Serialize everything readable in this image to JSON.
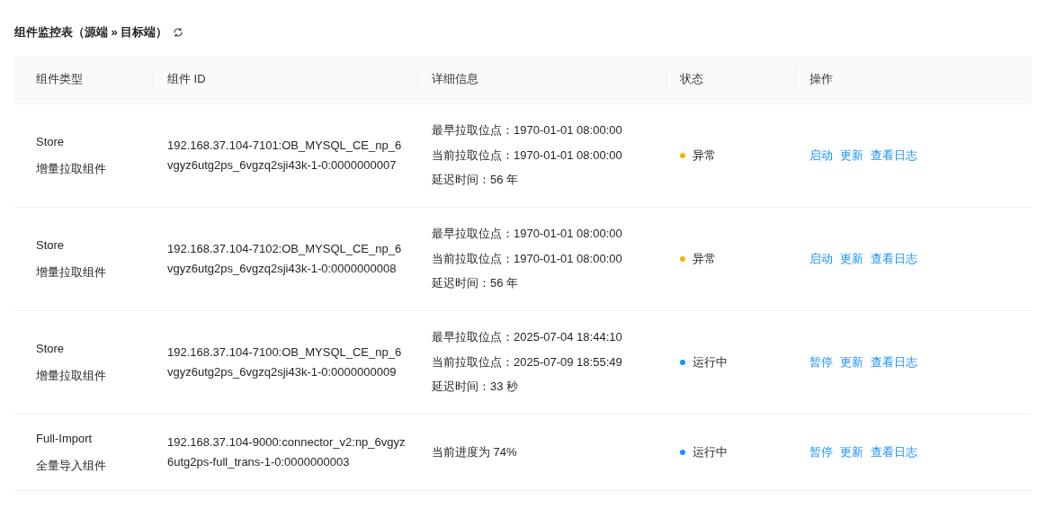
{
  "title": "组件监控表（源端 » 目标端）",
  "columns": [
    "组件类型",
    "组件 ID",
    "详细信息",
    "状态",
    "操作"
  ],
  "rows": [
    {
      "type": "Store",
      "type_label": "增量拉取组件",
      "id": "192.168.37.104-7101:OB_MYSQL_CE_np_6vgyz6utg2ps_6vgzq2sji43k-1-0:0000000007",
      "details": [
        "最早拉取位点：1970-01-01 08:00:00",
        "当前拉取位点：1970-01-01 08:00:00",
        "延迟时间：56 年"
      ],
      "status": {
        "label": "异常",
        "color": "#faad14"
      },
      "actions": [
        "启动",
        "更新",
        "查看日志"
      ]
    },
    {
      "type": "Store",
      "type_label": "增量拉取组件",
      "id": "192.168.37.104-7102:OB_MYSQL_CE_np_6vgyz6utg2ps_6vgzq2sji43k-1-0:0000000008",
      "details": [
        "最早拉取位点：1970-01-01 08:00:00",
        "当前拉取位点：1970-01-01 08:00:00",
        "延迟时间：56 年"
      ],
      "status": {
        "label": "异常",
        "color": "#faad14"
      },
      "actions": [
        "启动",
        "更新",
        "查看日志"
      ]
    },
    {
      "type": "Store",
      "type_label": "增量拉取组件",
      "id": "192.168.37.104-7100:OB_MYSQL_CE_np_6vgyz6utg2ps_6vgzq2sji43k-1-0:0000000009",
      "details": [
        "最早拉取位点：2025-07-04 18:44:10",
        "当前拉取位点：2025-07-09 18:55:49",
        "延迟时间：33 秒"
      ],
      "status": {
        "label": "运行中",
        "color": "#1890ff"
      },
      "actions": [
        "暂停",
        "更新",
        "查看日志"
      ]
    },
    {
      "type": "Full-Import",
      "type_label": "全量导入组件",
      "id": "192.168.37.104-9000:connector_v2:np_6vgyz6utg2ps-full_trans-1-0:0000000003",
      "details": [
        "当前进度为 74%"
      ],
      "status": {
        "label": "运行中",
        "color": "#1890ff"
      },
      "actions": [
        "暂停",
        "更新",
        "查看日志"
      ]
    }
  ]
}
